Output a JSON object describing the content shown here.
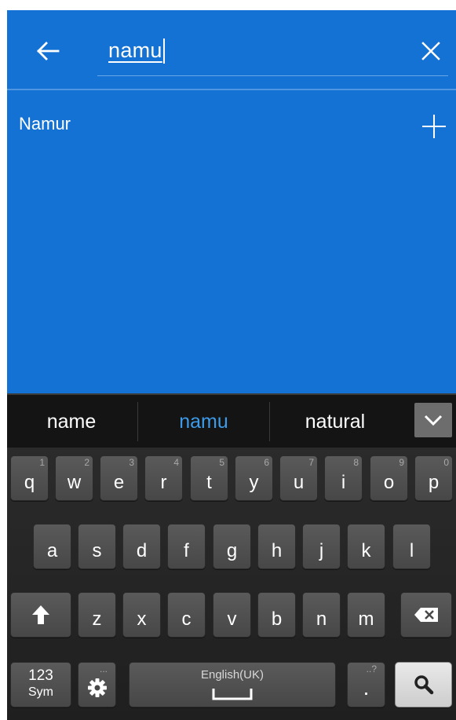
{
  "search": {
    "query": "namu"
  },
  "results": [
    {
      "label": "Namur"
    }
  ],
  "keyboard": {
    "suggestions": [
      "name",
      "namu",
      "natural"
    ],
    "row1": [
      {
        "ch": "q",
        "num": "1"
      },
      {
        "ch": "w",
        "num": "2"
      },
      {
        "ch": "e",
        "num": "3"
      },
      {
        "ch": "r",
        "num": "4"
      },
      {
        "ch": "t",
        "num": "5"
      },
      {
        "ch": "y",
        "num": "6"
      },
      {
        "ch": "u",
        "num": "7"
      },
      {
        "ch": "i",
        "num": "8"
      },
      {
        "ch": "o",
        "num": "9"
      },
      {
        "ch": "p",
        "num": "0"
      }
    ],
    "row2": [
      "a",
      "s",
      "d",
      "f",
      "g",
      "h",
      "j",
      "k",
      "l"
    ],
    "row3": [
      "z",
      "x",
      "c",
      "v",
      "b",
      "n",
      "m"
    ],
    "sym_label_top": "123",
    "sym_label_bottom": "Sym",
    "space_label": "English(UK)",
    "period_label": ".",
    "period_hint": "..?",
    "mic_hint": "..."
  },
  "colors": {
    "header_blue": "#1472d4",
    "suggestion_active": "#3d9be9",
    "keyboard_bg": "#242424",
    "key": "#515151"
  },
  "icons": {
    "back": "arrow-left-icon",
    "clear": "close-icon",
    "add": "plus-icon",
    "expand": "chevron-down-icon",
    "shift": "shift-arrow-icon",
    "backspace": "backspace-icon",
    "settings": "gear-icon",
    "space": "space-bar-icon",
    "search": "search-icon"
  }
}
